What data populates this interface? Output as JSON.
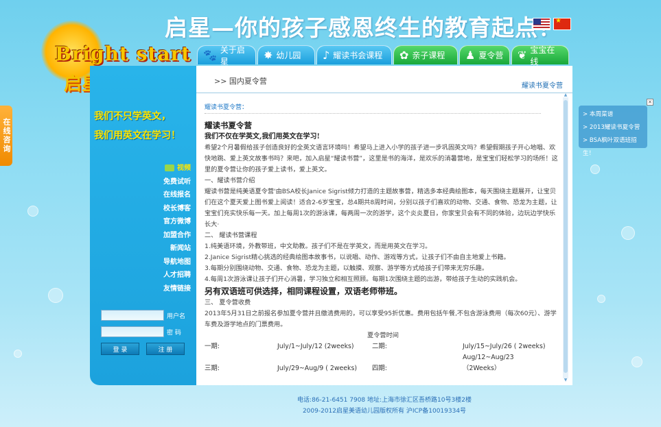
{
  "header": {
    "brand_en": "Bright start",
    "brand_cn": "启星",
    "slogan": "启星—你的孩子感恩终生的教育起点！"
  },
  "nav": {
    "tabs": [
      {
        "label": "关于启星",
        "icon": "paw-icon",
        "color": "blue"
      },
      {
        "label": "幼儿园",
        "icon": "star-icon",
        "color": "blue"
      },
      {
        "label": "耀读书会课程",
        "icon": "music-note-icon",
        "color": "blue"
      },
      {
        "label": "亲子课程",
        "icon": "family-icon",
        "color": "green"
      },
      {
        "label": "夏令营",
        "icon": "dancer-icon",
        "color": "green"
      },
      {
        "label": "宝宝在线",
        "icon": "bow-icon",
        "color": "green"
      }
    ]
  },
  "sidebar": {
    "motto_line1": "我们不只学英文，",
    "motto_line2": "我们用英文在学习！",
    "links": [
      "视频",
      "免费试听",
      "在线报名",
      "校长博客",
      "官方微博",
      "加盟合作",
      "新闻站",
      "导航地图",
      "人才招聘",
      "友情链接"
    ],
    "login": {
      "username_label": "用户名",
      "password_label": "密 码",
      "login_button": "登 录",
      "register_button": "注 册"
    }
  },
  "consult": {
    "label": "在线咨询"
  },
  "main": {
    "breadcrumb": ">> 国内夏令营",
    "right_link": "耀读书夏令营",
    "sub_link": "耀读书夏令营：",
    "title": "耀读书夏令营",
    "lead": "我们不仅在学英文,我们用英文在学习!",
    "intro": "希望2个月暑假给孩子创造良好的全英文语言环境吗！希望马上进入小学的孩子进一步巩固英文吗？希望假期孩子开心地唱、欢快地跳、爱上英文故事书吗？来吧，加入启星“耀读书营”，这里是书的海洋，是欢乐的消暑营地，是宝宝们轻松学习的场所！这里的夏令营让你的孩子爱上读书，爱上英文。",
    "sec1_title": "一、耀读书营介绍",
    "sec1_body": "耀读书营是纯美语夏令营'由BSA校长Janice Sigrist倾力打造的主题故事营，精选多本经典绘图本，每天围绕主题展开，让宝贝们在这个夏天爱上图书爱上阅读！适合2-6岁宝宝，总4期共8周时间，分别以孩子们喜欢的动物、交通、食物、恐龙为主题，让宝宝们充实快乐每一天。加上每周1次的游泳课，每两周一次的游学，这个炎炎夏日，你家宝贝会有不同的体验，边玩边学快乐长大·",
    "sec2_title": "二、 耀读书营课程",
    "sec2_items": [
      "1.纯美语环境，外教带班，中文助教。孩子们不是在学英文，而是用英文在学习。",
      "2.Janice Sigrist精心挑选的经典绘图本故事书，以说唱、动作、游戏等方式，让孩子们不由自主地爱上书籍。",
      "3.每期分别围绕动物、交通、食物、恐龙为主题，以触摸、观察、游学等方式给孩子们带来无穷乐趣。",
      "4.每周1次游泳课让孩子们开心消暑，学习独立和相互照顾。每期1次围绕主题的出游，带给孩子生动的实践机会。"
    ],
    "highlight": "另有双语班可供选择，相同课程设置，双语老师带班。",
    "sec3_title": "三、 夏令营收费",
    "sec3_body": "2013年5月31日之前报名参加夏令营并且缴清费用的，可以享受95折优惠。费用包括午餐,不包含游泳费用（每次60元）、游学车费及游学地点的门票费用。",
    "schedule_title": "夏令营时间",
    "schedule": [
      {
        "p1": "一期:",
        "d1": "July/1~July/12 (2weeks)",
        "p2": "二期:",
        "d2": "July/15~July/26 ( 2weeks)"
      },
      {
        "p1": "",
        "d1": "",
        "p2": "",
        "d2": "Aug/12~Aug/23"
      },
      {
        "p1": "三期:",
        "d1": "July/29~Aug/9 ( 2weeks)",
        "p2": "四期:",
        "d2": "（2Weeks）"
      }
    ]
  },
  "float_box": {
    "items": [
      "> 本周菜谱",
      "> 2013耀读书夏令营",
      "> BSA枫叶双语班招生！"
    ],
    "close": "×"
  },
  "footer": {
    "line1": "电话:86-21-6451 7908 地址:上海市徐汇区吾桥路10号3楼2楼",
    "line2": "2009-2012启星美语幼儿园版权所有 沪ICP备10019334号"
  },
  "colors": {
    "tab_blue": "#1b9fdc",
    "tab_green": "#19a83a",
    "sidebar": "#1ca2dd",
    "link": "#2079c7",
    "accent_yellow": "#ffe600"
  }
}
